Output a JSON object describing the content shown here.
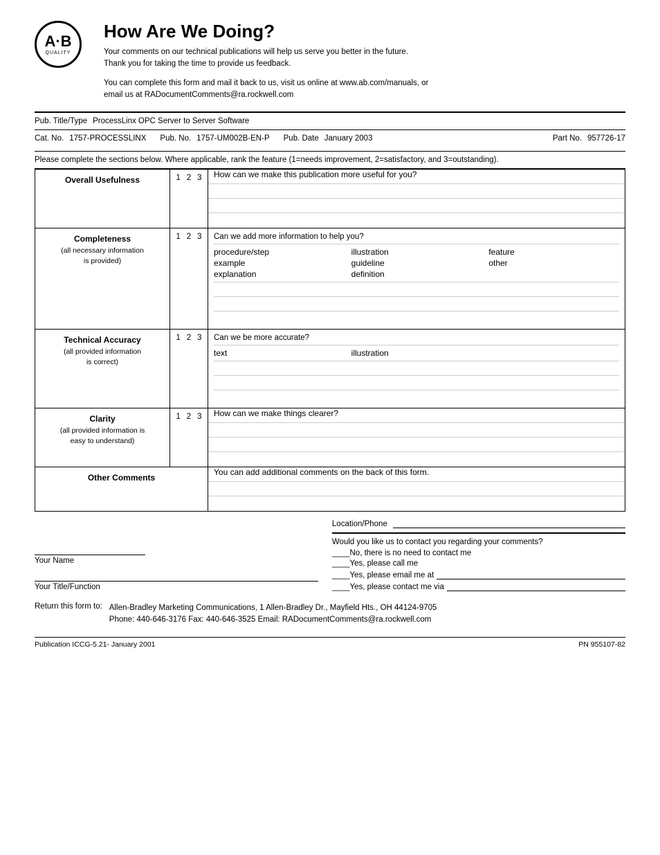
{
  "header": {
    "title": "How Are We Doing?",
    "subtitle_line1": "Your comments on our technical publications will help us serve you better in the future.",
    "subtitle_line2": "Thank you for taking the time to provide us feedback.",
    "contact_line1": "You can complete this form and mail it back to us, visit us online at www.ab.com/manuals, or",
    "contact_line2": "email us at RADocumentComments@ra.rockwell.com"
  },
  "logo": {
    "ab": "A·B",
    "quality": "QUALITY"
  },
  "pub": {
    "title_label": "Pub. Title/Type",
    "title_value": "ProcessLinx OPC Server to Server Software",
    "cat_label": "Cat. No.",
    "cat_value": "1757-PROCESSLINX",
    "pub_no_label": "Pub. No.",
    "pub_no_value": "1757-UM002B-EN-P",
    "pub_date_label": "Pub. Date",
    "pub_date_value": "January 2003",
    "part_no_label": "Part No.",
    "part_no_value": "957726-17"
  },
  "instructions": "Please complete the sections below. Where applicable, rank the feature (1=needs improvement, 2=satisfactory, and 3=outstanding).",
  "sections": [
    {
      "id": "overall-usefulness",
      "label": "Overall Usefulness",
      "sublabel": "",
      "ratings": [
        "1",
        "2",
        "3"
      ],
      "question": "How can we make this publication more useful for you?",
      "checklist": [],
      "lines": 3
    },
    {
      "id": "completeness",
      "label": "Completeness",
      "sublabel": "(all necessary information is provided)",
      "ratings": [
        "1",
        "2",
        "3"
      ],
      "question": "Can we add more information to help you?",
      "checklist": [
        "procedure/step",
        "illustration",
        "feature",
        "example",
        "guideline",
        "other",
        "explanation",
        "definition",
        ""
      ],
      "lines": 3
    },
    {
      "id": "technical-accuracy",
      "label": "Technical Accuracy",
      "sublabel": "(all provided information is correct)",
      "ratings": [
        "1",
        "2",
        "3"
      ],
      "question": "Can we be more accurate?",
      "checklist": [
        "text",
        "illustration",
        ""
      ],
      "lines": 3
    },
    {
      "id": "clarity",
      "label": "Clarity",
      "sublabel": "(all provided information is easy to understand)",
      "ratings": [
        "1",
        "2",
        "3"
      ],
      "question": "How can we make things clearer?",
      "checklist": [],
      "lines": 3
    },
    {
      "id": "other-comments",
      "label": "Other Comments",
      "sublabel": "",
      "ratings": [],
      "question": "You can add additional comments on the back of this form.",
      "checklist": [],
      "lines": 2
    }
  ],
  "form": {
    "your_name_label": "Your Name",
    "your_title_label": "Your Title/Function",
    "location_phone_label": "Location/Phone",
    "contact_question": "Would you like us to contact you regarding your comments?",
    "no_contact": "____No, there is no need to contact me",
    "yes_call": "____Yes, please call me",
    "yes_email": "____Yes, please email me at",
    "yes_contact_via": "____Yes, please contact me via"
  },
  "return": {
    "label": "Return this form to:",
    "address": "Allen-Bradley Marketing Communications, 1 Allen-Bradley Dr., Mayfield Hts., OH 44124-9705",
    "phone_fax_email": "Phone: 440-646-3176 Fax: 440-646-3525 Email: RADocumentComments@ra.rockwell.com"
  },
  "footer": {
    "publication": "Publication  ICCG-5.21-  January 2001",
    "part_no": "PN 955107-82"
  }
}
